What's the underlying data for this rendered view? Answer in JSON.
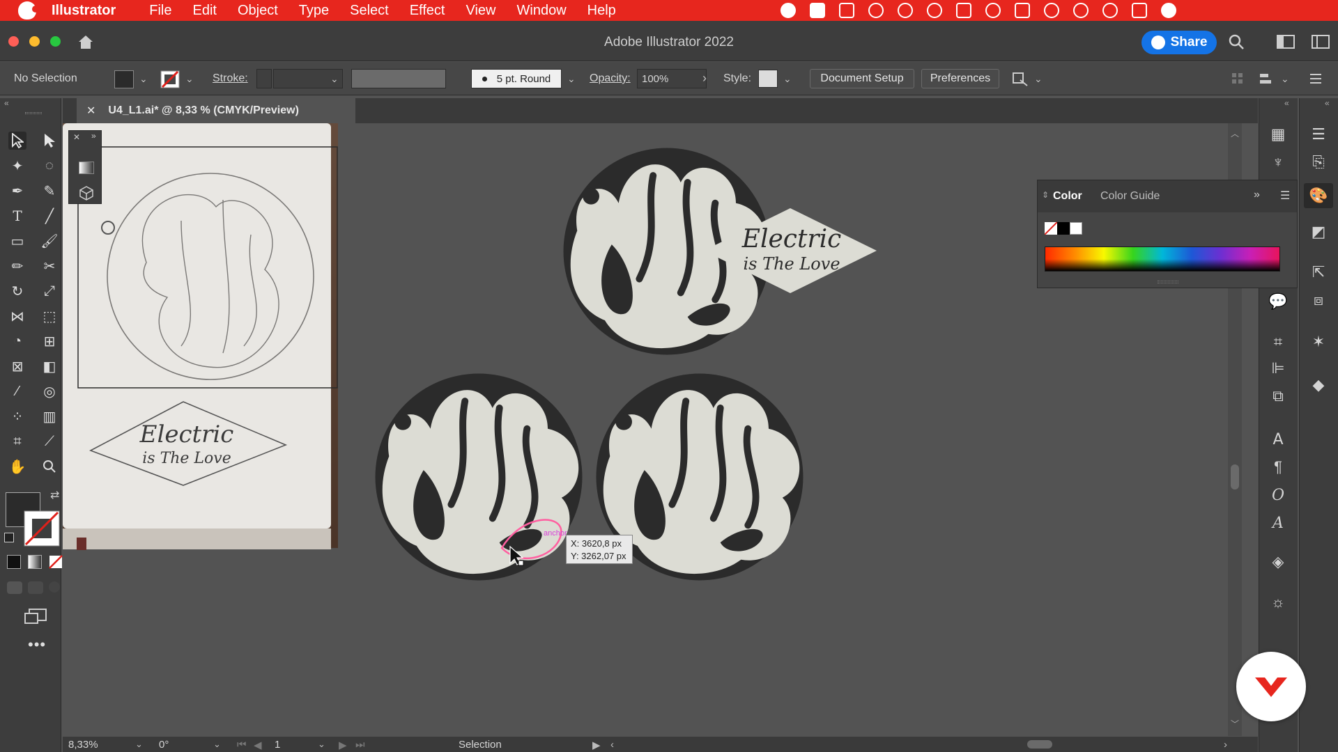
{
  "menubar": {
    "app_name": "Illustrator",
    "items": [
      "File",
      "Edit",
      "Object",
      "Type",
      "Select",
      "Effect",
      "View",
      "Window",
      "Help"
    ]
  },
  "titlebar": {
    "title": "Adobe Illustrator 2022",
    "share_label": "Share"
  },
  "controlbar": {
    "selection_label": "No Selection",
    "stroke_label": "Stroke:",
    "brush_label": "5 pt. Round",
    "opacity_label": "Opacity:",
    "opacity_value": "100%",
    "style_label": "Style:",
    "document_setup_label": "Document Setup",
    "preferences_label": "Preferences"
  },
  "document_tab": {
    "title": "U4_L1.ai* @ 8,33 % (CMYK/Preview)",
    "close_glyph": "✕"
  },
  "color_panel": {
    "tabs": [
      "Color",
      "Color Guide"
    ]
  },
  "artwork": {
    "sketch_badge_top": "Electric",
    "sketch_badge_bottom": "is The Love",
    "badge_top": "Electric",
    "badge_bottom": "is The Love",
    "anchor_label": "anchor"
  },
  "coordinate_tooltip": {
    "x": "X: 3620,8 px",
    "y": "Y: 3262,07 px"
  },
  "statusbar": {
    "zoom": "8,33%",
    "rotation": "0°",
    "artboard": "1",
    "tool": "Selection"
  },
  "colors": {
    "menubar": "#e7261e",
    "accent": "#1473e6",
    "artwork_dark": "#2b2b2b",
    "artwork_light": "#dcdcd4"
  }
}
